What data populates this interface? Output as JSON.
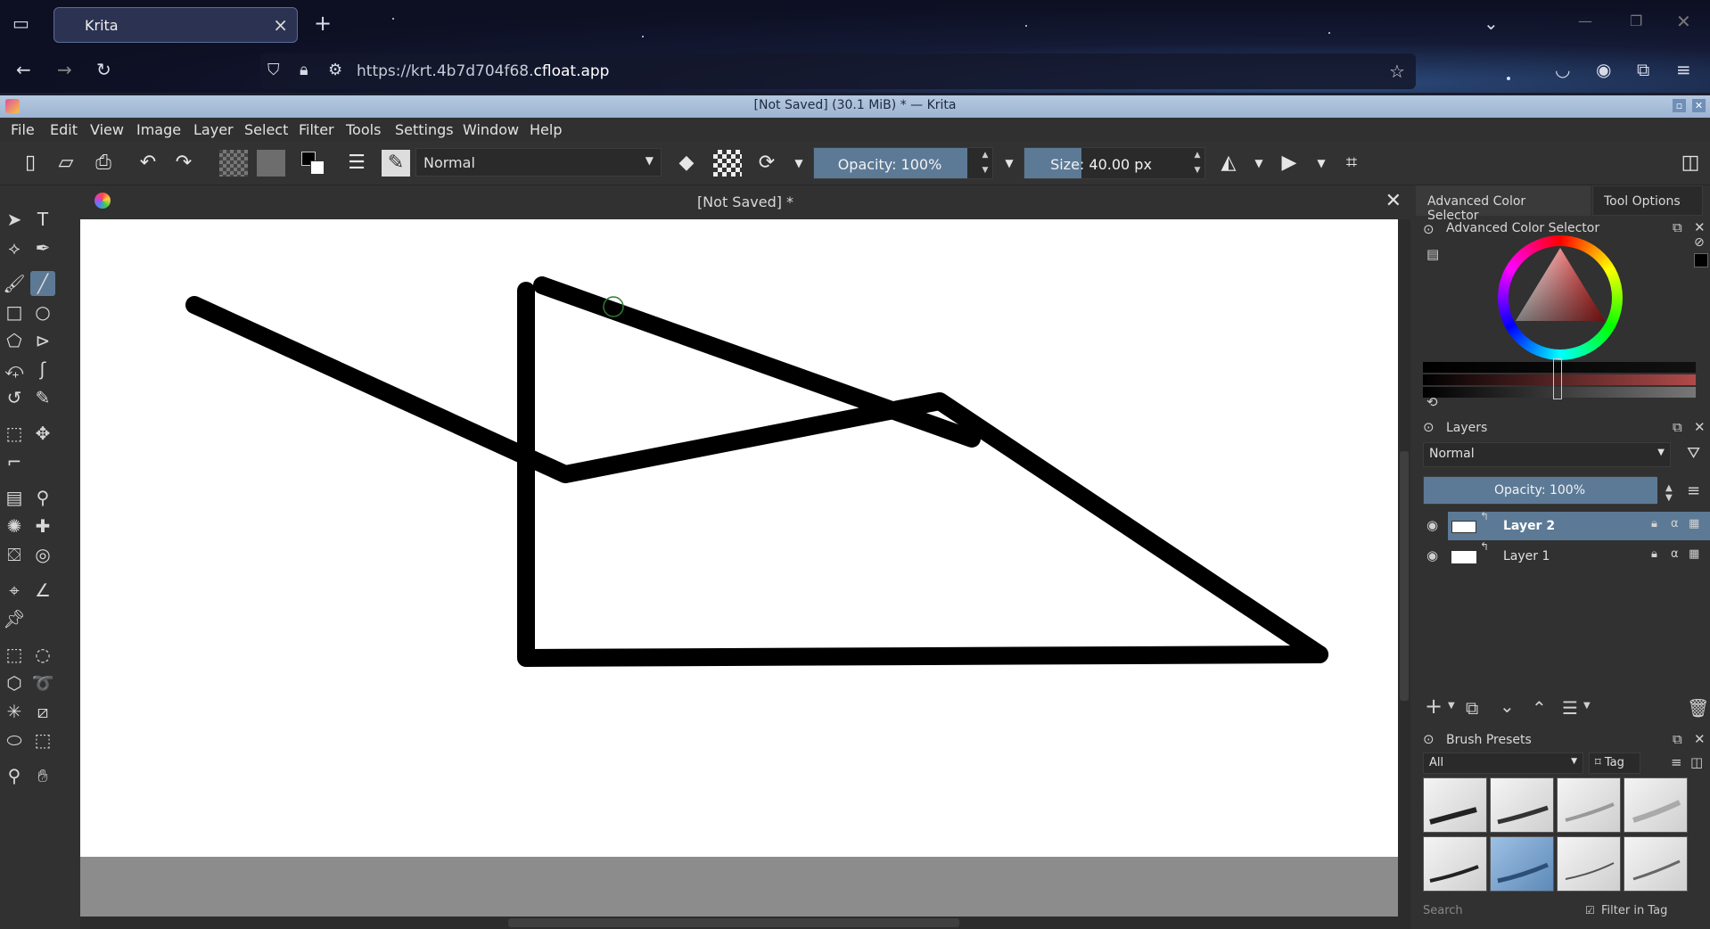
{
  "browser": {
    "tab_title": "Krita",
    "url_prefix": "https://krt.4b7d704f68.",
    "url_domain": "cfloat.app"
  },
  "window": {
    "title": "[Not Saved]  (30.1 MiB)  * — Krita"
  },
  "menu": [
    "File",
    "Edit",
    "View",
    "Image",
    "Layer",
    "Select",
    "Filter",
    "Tools",
    "Settings",
    "Window",
    "Help"
  ],
  "toolbar": {
    "blend_mode": "Normal",
    "opacity_label": "Opacity: 100%",
    "opacity_value": 100,
    "size_label": "Size: 40.00 px",
    "size_value": 40.0
  },
  "document": {
    "tab_title": "[Not Saved]  *"
  },
  "dockers": {
    "tabs": [
      "Advanced Color Selector",
      "Tool Options"
    ],
    "color_selector_title": "Advanced Color Selector",
    "layers_title": "Layers",
    "layers_blend_mode": "Normal",
    "layers_opacity_label": "Opacity:  100%",
    "layers": [
      {
        "name": "Layer 2",
        "selected": true
      },
      {
        "name": "Layer 1",
        "selected": false
      }
    ],
    "brush_presets_title": "Brush Presets",
    "brush_filter": "All",
    "tag_label": "Tag",
    "search_placeholder": "Search",
    "filter_in_tag_label": "Filter in Tag"
  },
  "colors": {
    "accent": "#5c7a96",
    "stroke": "#000000"
  }
}
